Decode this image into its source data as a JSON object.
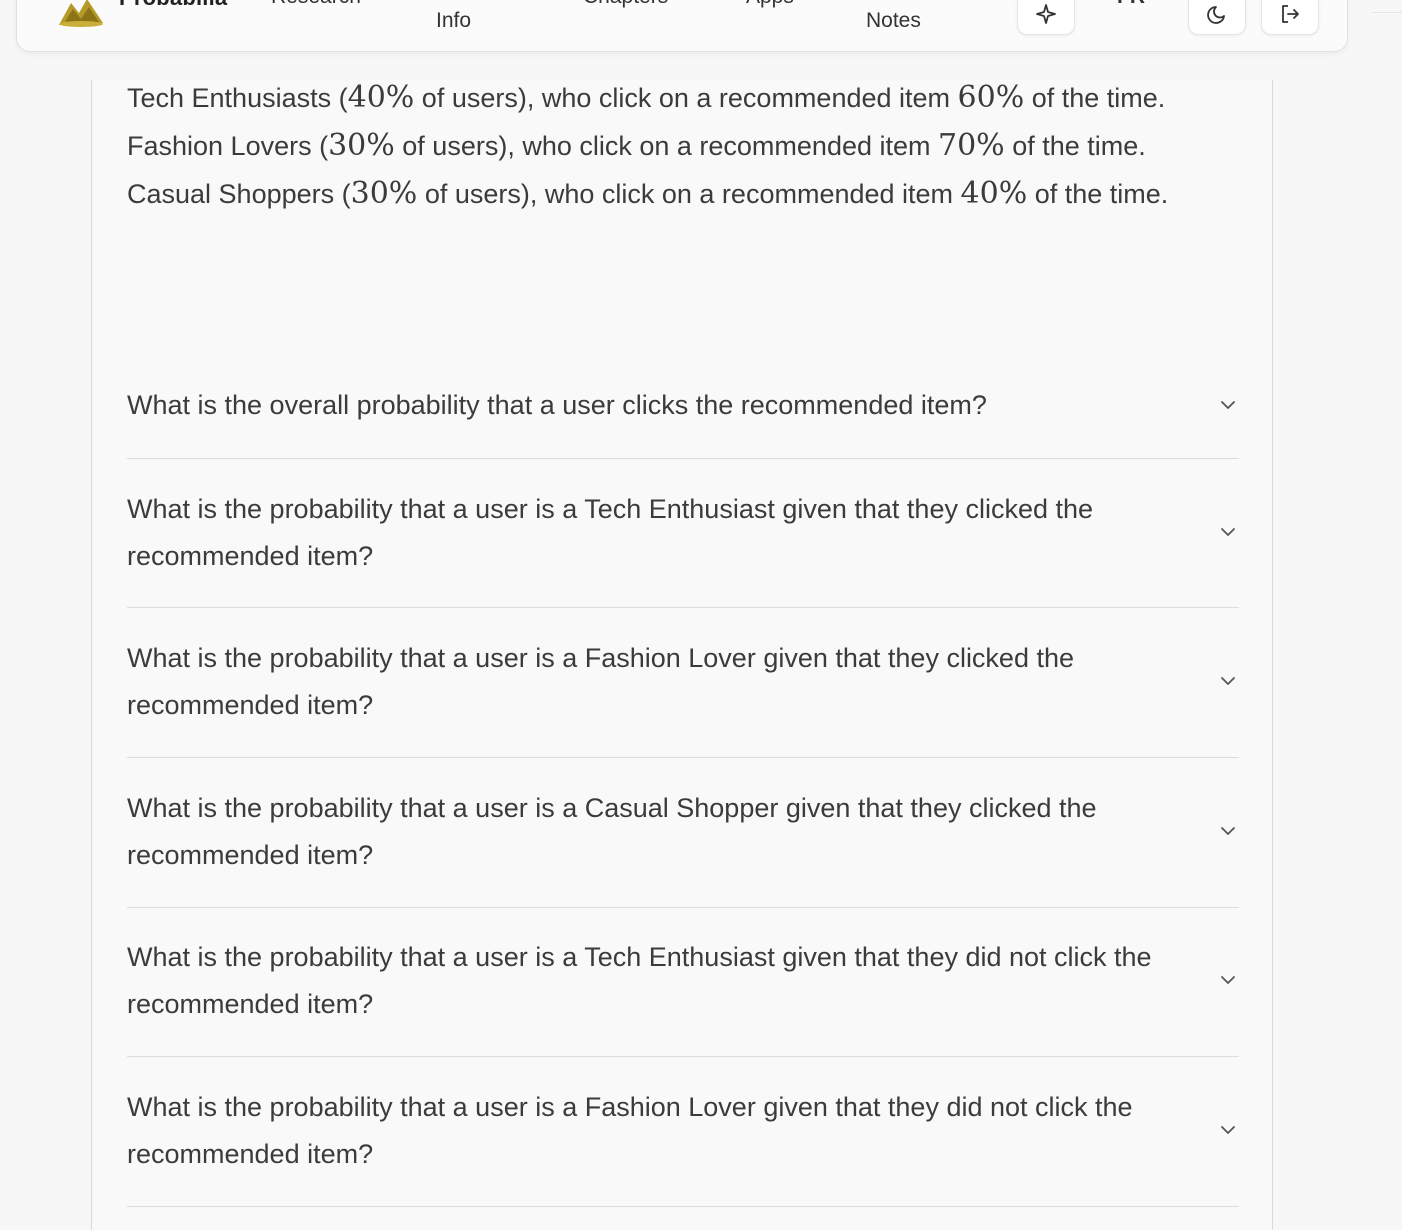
{
  "nav": {
    "brand": "Probabilia",
    "links": {
      "research": "Research",
      "info": "Info",
      "chapters": "Chapters",
      "apps": "Apps",
      "notes": "Notes"
    },
    "lang": "FR",
    "icons": {
      "logo": "probabilia-logo",
      "sparkle": "sparkle-icon",
      "theme": "theme-toggle-icon",
      "logout": "logout-icon"
    }
  },
  "intro": {
    "tech": {
      "a": "Tech Enthusiasts (",
      "pct": "40%",
      "b": " of users), who click on a recommended item ",
      "rate": "60%",
      "c": " of the time."
    },
    "fashion": {
      "a": "Fashion Lovers (",
      "pct": "30%",
      "b": " of users), who click on a recommended item ",
      "rate": "70%",
      "c": " of the time."
    },
    "casual": {
      "a": "Casual Shoppers (",
      "pct": "30%",
      "b": " of users), who click on a recommended item ",
      "rate": "40%",
      "c": " of the time."
    }
  },
  "questions": [
    "What is the overall probability that a user clicks the recommended item?",
    "What is the probability that a user is a Tech Enthusiast given that they clicked the recommended item?",
    "What is the probability that a user is a Fashion Lover given that they clicked the recommended item?",
    "What is the probability that a user is a Casual Shopper given that they clicked the recommended item?",
    "What is the probability that a user is a Tech Enthusiast given that they did not click the recommended item?",
    "What is the probability that a user is a Fashion Lover given that they did not click the recommended item?"
  ],
  "colors": {
    "accent": "#a08a1e",
    "text": "#3b3b3b",
    "divider": "#dcdcdc"
  }
}
